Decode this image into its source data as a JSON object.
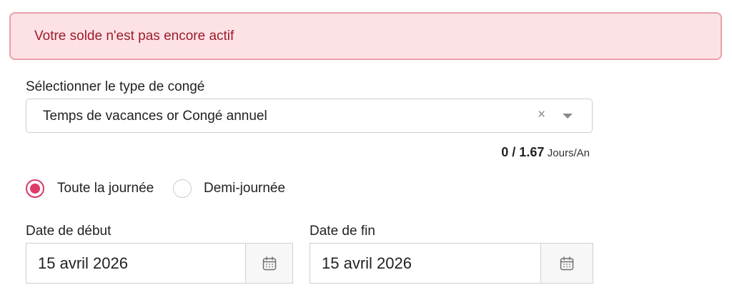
{
  "alert": {
    "message": "Votre solde n'est pas encore actif"
  },
  "leave_type": {
    "label": "Sélectionner le type de congé",
    "selected": "Temps de vacances or Congé annuel",
    "clear_glyph": "×"
  },
  "balance": {
    "used": "0 / 1.67",
    "unit": "Jours/An"
  },
  "duration": {
    "options": [
      {
        "label": "Toute la journée",
        "checked": true
      },
      {
        "label": "Demi-journée",
        "checked": false
      }
    ]
  },
  "start_date": {
    "label": "Date de début",
    "value": "15 avril 2026"
  },
  "end_date": {
    "label": "Date de fin",
    "value": "15 avril 2026"
  },
  "colors": {
    "accent": "#e03a6b",
    "alert_bg": "#fde2e5",
    "alert_text": "#9b1c2c"
  },
  "icons": {
    "clear": "close-icon",
    "dropdown": "chevron-down-icon",
    "calendar": "calendar-icon"
  }
}
